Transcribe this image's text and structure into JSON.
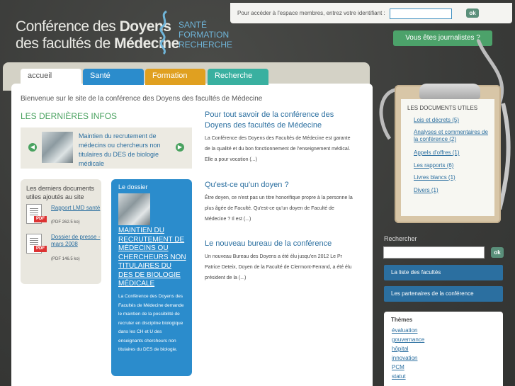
{
  "logo": {
    "line1_a": "Conférence des ",
    "line1_b": "Doyens",
    "line2_a": "des facultés de ",
    "line2_b": "Médecine",
    "tags": [
      "SANTÉ",
      "FORMATION",
      "RECHERCHE"
    ]
  },
  "members": {
    "label": "Pour accéder à l'espace membres, entrez votre identifiant :",
    "ok": "ok"
  },
  "journalists_button": "Vous êtes journalistes ?",
  "tabs": [
    "accueil",
    "Santé",
    "Formation",
    "Recherche"
  ],
  "welcome": "Bienvenue sur le site de la conférence des Doyens des facultés de Médecine",
  "latest_title": "LES DERNIÈRES INFOS",
  "news_item": "Maintien du recrutement de médecins ou chercheurs non titulaires du DES de biologie médicale",
  "docs": {
    "title": "Les derniers documents utiles ajoutés au site",
    "items": [
      {
        "label": "Rapport LMD santé",
        "size": "(PDF 262.5 ko)"
      },
      {
        "label": "Dossier de presse - mars 2008",
        "size": "(PDF 146.5 ko)"
      }
    ],
    "pdf": "PDF"
  },
  "dossier": {
    "label": "Le dossier",
    "title": "MAINTIEN DU RECRUTEMENT DE MÉDECINS OU CHERCHEURS NON TITULAIRES DU DES DE BIOLOGIE MÉDICALE",
    "text": "La Conférence des Doyens des Facultés de Médecine demande le maintien de la possibilité de recruter en discipline biologique dans les CH et U des enseignants chercheurs non titulaires du DES de biologie."
  },
  "articles": [
    {
      "title": "Pour tout savoir de la conférence des Doyens des facultés de Médecine",
      "text": "La Conférence des Doyens des Facultés de Médecine est garante de la qualité et du bon fonctionnement de l'enseignement médical. Elle a pour vocation (...)"
    },
    {
      "title": "Qu'est-ce qu'un doyen ?",
      "text": "Être doyen, ce n'est pas un titre honorifique propre à la personne la plus âgée de Faculté. Qu'est-ce qu'un doyen de Faculté de Médecine ? Il est (...)"
    },
    {
      "title": "Le nouveau bureau de la conférence",
      "text": "Un nouveau Bureau des Doyens a été élu jusqu'en 2012 Le Pr Patrice Deteix, Doyen de la Faculté de Clermont-Ferrand, a été élu président de la (...)"
    }
  ],
  "useful_docs": {
    "heading": "LES DOCUMENTS UTILES",
    "links": [
      "Lois et décrets (5)",
      "Analyses et commentaires de la conférence (2)",
      "Appels d'offres (1)",
      "Les rapports (6)",
      "Livres blancs (1)",
      "Divers (1)"
    ]
  },
  "search": {
    "label": "Rechercher",
    "ok": "ok"
  },
  "side_buttons": [
    "La liste des facultés",
    "Les partenaires de la conférence"
  ],
  "themes": {
    "title": "Thèmes",
    "links": [
      "évaluation",
      "gouvernance",
      "hôpital",
      "innovation",
      "PCM",
      "statut"
    ]
  },
  "colors": {
    "green": "#4aa260",
    "blue": "#2b8ccc",
    "orange": "#e0a020",
    "teal": "#39b0a0",
    "link": "#2b6fa0"
  }
}
